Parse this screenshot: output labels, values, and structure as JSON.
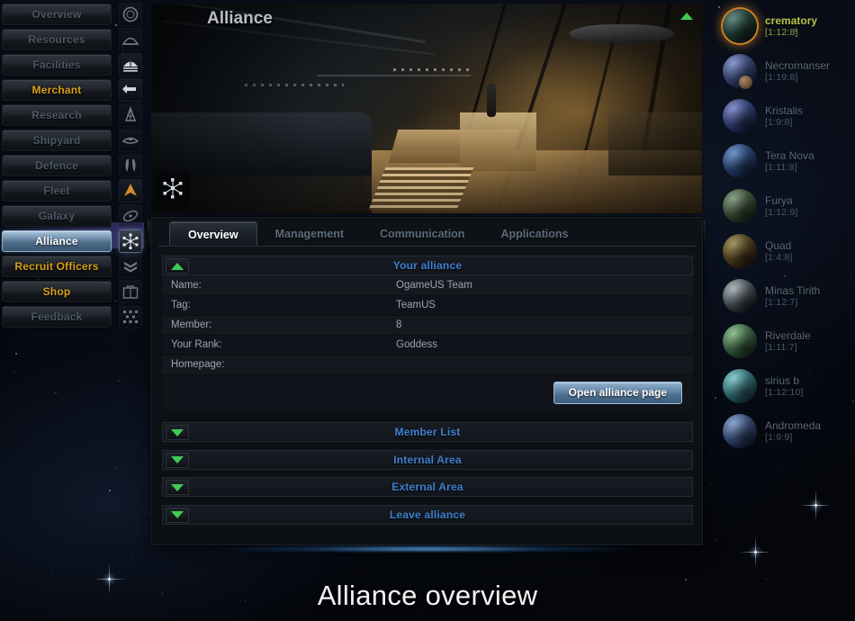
{
  "caption": "Alliance overview",
  "banner": {
    "title": "Alliance",
    "collapse_icon": "triangle-up-icon",
    "badge_icon": "alliance-network-icon"
  },
  "sidebar": {
    "items": [
      {
        "label": "Overview",
        "state": "dim",
        "icon": "overview-icon"
      },
      {
        "label": "Resources",
        "state": "dim",
        "icon": "resources-icon"
      },
      {
        "label": "Facilities",
        "state": "dim",
        "icon": "facilities-icon"
      },
      {
        "label": "Merchant",
        "state": "gold",
        "icon": "merchant-icon"
      },
      {
        "label": "Research",
        "state": "dim",
        "icon": "research-icon"
      },
      {
        "label": "Shipyard",
        "state": "dim",
        "icon": "shipyard-icon"
      },
      {
        "label": "Defence",
        "state": "dim",
        "icon": "defence-icon"
      },
      {
        "label": "Fleet",
        "state": "dim",
        "icon": "fleet-icon"
      },
      {
        "label": "Galaxy",
        "state": "dim",
        "icon": "galaxy-icon"
      },
      {
        "label": "Alliance",
        "state": "active",
        "icon": "alliance-icon"
      },
      {
        "label": "Recruit Officers",
        "state": "gold",
        "icon": "officers-icon"
      },
      {
        "label": "Shop",
        "state": "gold",
        "icon": "shop-icon"
      },
      {
        "label": "Feedback",
        "state": "dim",
        "icon": "feedback-icon"
      }
    ]
  },
  "tabs": [
    {
      "label": "Overview",
      "active": true
    },
    {
      "label": "Management",
      "active": false
    },
    {
      "label": "Communication",
      "active": false
    },
    {
      "label": "Applications",
      "active": false
    }
  ],
  "sections": {
    "your_alliance": {
      "title": "Your alliance",
      "expanded": true,
      "rows": [
        {
          "key": "Name:",
          "value": "OgameUS Team"
        },
        {
          "key": "Tag:",
          "value": "TeamUS"
        },
        {
          "key": "Member:",
          "value": "8"
        },
        {
          "key": "Your Rank:",
          "value": "Goddess"
        },
        {
          "key": "Homepage:",
          "value": ""
        }
      ],
      "button": "Open alliance page"
    },
    "collapsed": [
      {
        "title": "Member List"
      },
      {
        "title": "Internal Area"
      },
      {
        "title": "External Area"
      },
      {
        "title": "Leave alliance"
      }
    ]
  },
  "planets": [
    {
      "name": "crematory",
      "coords": "[1:12:8]",
      "active": true,
      "color_a": "#3f6a5e",
      "color_b": "#10201c",
      "moon": false
    },
    {
      "name": "Necromanser",
      "coords": "[1:19:8]",
      "active": false,
      "color_a": "#6b7fc0",
      "color_b": "#1a2445",
      "moon": true
    },
    {
      "name": "Kristalis",
      "coords": "[1:9:8]",
      "active": false,
      "color_a": "#6374bd",
      "color_b": "#171f42",
      "moon": false
    },
    {
      "name": "Tera Nova",
      "coords": "[1:11:8]",
      "active": false,
      "color_a": "#4d79bb",
      "color_b": "#142240",
      "moon": false
    },
    {
      "name": "Furya",
      "coords": "[1:12:9]",
      "active": false,
      "color_a": "#6e8a6a",
      "color_b": "#1d2a1c",
      "moon": false
    },
    {
      "name": "Quad",
      "coords": "[1:4:8]",
      "active": false,
      "color_a": "#8a7a3c",
      "color_b": "#2b1d10",
      "moon": false
    },
    {
      "name": "Minas Tirith",
      "coords": "[1:12:7]",
      "active": false,
      "color_a": "#9aa7ad",
      "color_b": "#1b2024",
      "moon": false
    },
    {
      "name": "Riverdale",
      "coords": "[1:11:7]",
      "active": false,
      "color_a": "#76b07a",
      "color_b": "#1b3424",
      "moon": false
    },
    {
      "name": "sirius b",
      "coords": "[1:12:10]",
      "active": false,
      "color_a": "#69c0c4",
      "color_b": "#173c44",
      "moon": false
    },
    {
      "name": "Andromeda",
      "coords": "[1:9:9]",
      "active": false,
      "color_a": "#6f8fc2",
      "color_b": "#1a2444",
      "moon": false
    }
  ],
  "colors": {
    "accent_blue": "#3f80cf",
    "accent_green": "#3fcc52",
    "gold": "#d9a21c",
    "active_planet": "#b8c44a",
    "panel_bg": "#0e1116"
  }
}
